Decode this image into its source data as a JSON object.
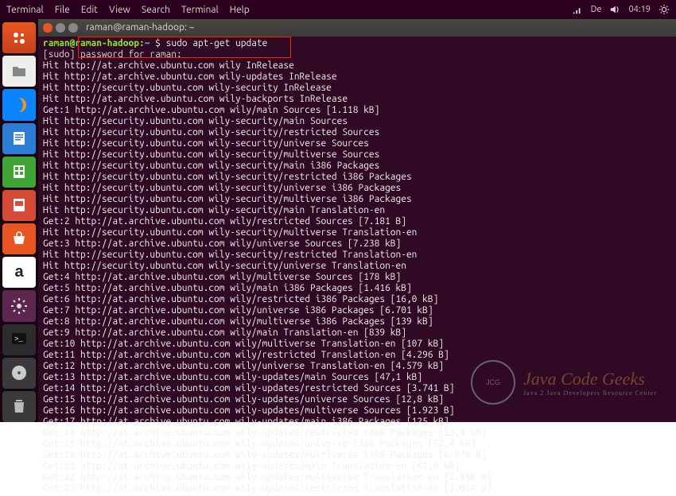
{
  "topbar": {
    "menus": [
      "Terminal",
      "File",
      "Edit",
      "View",
      "Search",
      "Terminal",
      "Help"
    ],
    "lang": "De",
    "time": "04:19"
  },
  "launcher": {
    "items": [
      "dash",
      "files",
      "firefox",
      "writer",
      "calc",
      "impress",
      "software",
      "amazon",
      "settings",
      "terminal",
      "music",
      "trash"
    ]
  },
  "window": {
    "title": "raman@raman-hadoop: ~"
  },
  "prompt": {
    "userhost": "raman@raman-hadoop",
    "path": "~",
    "symbol": "$",
    "command": "sudo apt-get update"
  },
  "sudo_line": "[sudo] password for raman:",
  "output": [
    "Hit http://at.archive.ubuntu.com wily InRelease",
    "Hit http://at.archive.ubuntu.com wily-updates InRelease",
    "Hit http://security.ubuntu.com wily-security InRelease",
    "Hit http://at.archive.ubuntu.com wily-backports InRelease",
    "Get:1 http://at.archive.ubuntu.com wily/main Sources [1.118 kB]",
    "Hit http://security.ubuntu.com wily-security/main Sources",
    "Hit http://security.ubuntu.com wily-security/restricted Sources",
    "Hit http://security.ubuntu.com wily-security/universe Sources",
    "Hit http://security.ubuntu.com wily-security/multiverse Sources",
    "Hit http://security.ubuntu.com wily-security/main i386 Packages",
    "Hit http://security.ubuntu.com wily-security/restricted i386 Packages",
    "Hit http://security.ubuntu.com wily-security/universe i386 Packages",
    "Hit http://security.ubuntu.com wily-security/multiverse i386 Packages",
    "Hit http://security.ubuntu.com wily-security/main Translation-en",
    "Get:2 http://at.archive.ubuntu.com wily/restricted Sources [7.181 B]",
    "Hit http://security.ubuntu.com wily-security/multiverse Translation-en",
    "Get:3 http://at.archive.ubuntu.com wily/universe Sources [7.238 kB]",
    "Hit http://security.ubuntu.com wily-security/restricted Translation-en",
    "Hit http://security.ubuntu.com wily-security/universe Translation-en",
    "Get:4 http://at.archive.ubuntu.com wily/multiverse Sources [178 kB]",
    "Get:5 http://at.archive.ubuntu.com wily/main i386 Packages [1.416 kB]",
    "Get:6 http://at.archive.ubuntu.com wily/restricted i386 Packages [16,0 kB]",
    "Get:7 http://at.archive.ubuntu.com wily/universe i386 Packages [6.701 kB]",
    "Get:8 http://at.archive.ubuntu.com wily/multiverse i386 Packages [139 kB]",
    "Get:9 http://at.archive.ubuntu.com wily/main Translation-en [839 kB]",
    "Get:10 http://at.archive.ubuntu.com wily/multiverse Translation-en [107 kB]",
    "Get:11 http://at.archive.ubuntu.com wily/restricted Translation-en [4.296 B]",
    "Get:12 http://at.archive.ubuntu.com wily/universe Translation-en [4.579 kB]",
    "Get:13 http://at.archive.ubuntu.com wily-updates/main Sources [47,1 kB]",
    "Get:14 http://at.archive.ubuntu.com wily-updates/restricted Sources [3.741 B]",
    "Get:15 http://at.archive.ubuntu.com wily-updates/universe Sources [12,8 kB]",
    "Get:16 http://at.archive.ubuntu.com wily-updates/multiverse Sources [1.923 B]",
    "Get:17 http://at.archive.ubuntu.com wily-updates/main i386 Packages [125 kB]",
    "Get:18 http://at.archive.ubuntu.com wily-updates/restricted i386 Packages [13,4 kB]",
    "Get:19 http://at.archive.ubuntu.com wily-updates/universe i386 Packages [52,4 kB]",
    "Get:20 http://at.archive.ubuntu.com wily-updates/multiverse i386 Packages [6.076 B]",
    "Get:21 http://at.archive.ubuntu.com wily-updates/main Translation-en [61,8 kB]",
    "Get:22 http://at.archive.ubuntu.com wily-updates/multiverse Translation-en [2.536 B]",
    "Get:23 http://at.archive.ubuntu.com wily-updates/restricted Translation-en [3.024 B]"
  ],
  "watermark": {
    "badge": "JCG",
    "line1": "Java Code Geeks",
    "line2": "Java 2 Java Developers Resource Center"
  }
}
